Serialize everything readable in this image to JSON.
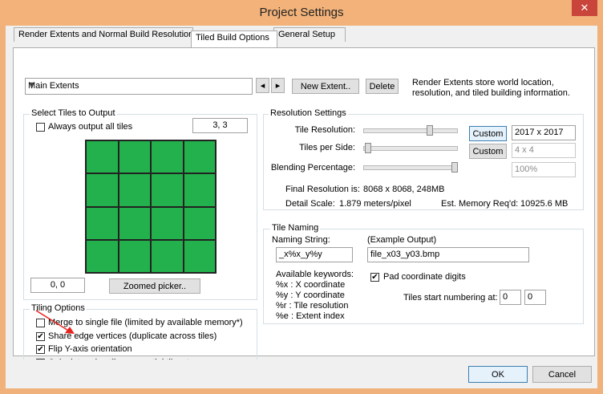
{
  "window": {
    "title": "Project Settings",
    "close_glyph": "✕"
  },
  "tabs": [
    {
      "label": "Render Extents and Normal Build Resolution"
    },
    {
      "label": "Tiled Build Options"
    },
    {
      "label": "General Setup"
    }
  ],
  "extents": {
    "selected": "Main Extents",
    "prev_glyph": "◂",
    "next_glyph": "▸",
    "new_label": "New Extent..",
    "delete_label": "Delete",
    "info": "Render Extents store world location, resolution, and tiled building information."
  },
  "select_tiles": {
    "title": "Select Tiles to Output",
    "always_output_label": "Always output all tiles",
    "always_output_checked": false,
    "count_value": "3, 3",
    "origin_value": "0, 0",
    "zoomed_picker_label": "Zoomed picker..",
    "grid_rows": 4,
    "grid_cols": 4
  },
  "tiling_options": {
    "title": "Tiling Options",
    "items": [
      {
        "label": "Merge to single file (limited by available memory*)",
        "checked": false
      },
      {
        "label": "Share edge vertices (duplicate across tiles)",
        "checked": true
      },
      {
        "label": "Flip Y-axis orientation",
        "checked": true
      },
      {
        "label": "Calculate edge tiles on partial tilesets",
        "checked": false
      }
    ]
  },
  "resolution": {
    "title": "Resolution Settings",
    "tile_resolution_label": "Tile Resolution:",
    "tile_resolution_value": "2017 x 2017",
    "tiles_per_side_label": "Tiles per Side:",
    "tiles_per_side_value": "4 x 4",
    "blending_label": "Blending Percentage:",
    "blending_value": "100%",
    "custom_label": "Custom",
    "final_resolution_label": "Final Resolution is:",
    "final_resolution_value": "8068 x 8068, 248MB",
    "detail_scale_label": "Detail Scale:",
    "detail_scale_value": "1.879 meters/pixel",
    "memory_label": "Est. Memory Req'd:",
    "memory_value": "10925.6 MB",
    "tile_resolution_level": 0.72,
    "tiles_per_side_level": 0.02,
    "blending_level": 1.0
  },
  "tile_naming": {
    "title": "Tile Naming",
    "naming_string_label": "Naming String:",
    "naming_string_value": "_x%x_y%y",
    "example_label": "(Example Output)",
    "example_value": "file_x03_y03.bmp",
    "keywords_title": "Available keywords:",
    "keywords": [
      "%x : X coordinate",
      "%y : Y coordinate",
      "%r  : Tile resolution",
      "%e : Extent index"
    ],
    "pad_label": "Pad coordinate digits",
    "pad_checked": true,
    "start_label": "Tiles start numbering at:",
    "start_x": "0",
    "start_y": "0"
  },
  "dialog": {
    "ok_label": "OK",
    "cancel_label": "Cancel"
  },
  "colors": {
    "tile_green": "#22b14c",
    "title_bar": "#f2b27a",
    "annotation_arrow": "#e8231e"
  }
}
